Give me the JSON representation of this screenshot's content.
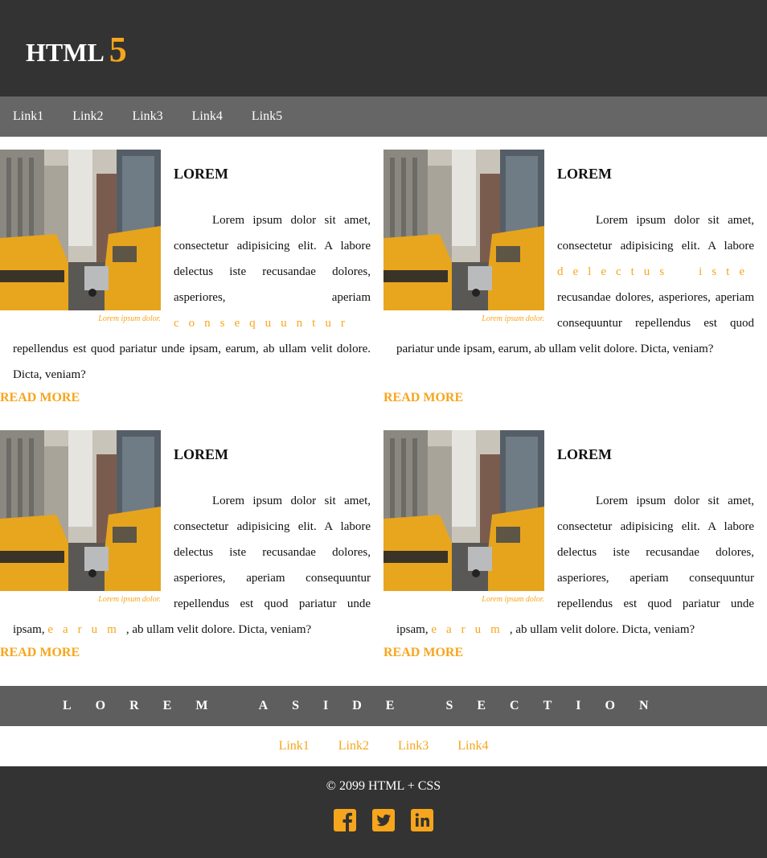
{
  "header": {
    "logo_text": "HTML",
    "logo_num": "5"
  },
  "nav": {
    "links": [
      "Link1",
      "Link2",
      "Link3",
      "Link4",
      "Link5"
    ]
  },
  "articles": [
    {
      "title": "LOREM",
      "caption": "Lorem ipsum dolor.",
      "text_1": "Lorem ipsum dolor sit amet, consectetur adipisicing elit. A labore delectus iste recusandae dolores, asperiores, aperiam",
      "highlight": "consequuntur",
      "text_2": " repellendus est quod pariatur unde ipsam, earum, ab ullam velit dolore. Dicta, veniam?",
      "read_more": "READ MORE"
    },
    {
      "title": "LOREM",
      "caption": "Lorem ipsum dolor.",
      "text_1": "Lorem ipsum dolor sit amet, consectetur adipisicing elit. A labore ",
      "highlight": "delectus iste",
      "text_2": " recusandae dolores, asperiores, aperiam consequuntur repellendus est quod pariatur unde ipsam, earum, ab ullam velit dolore. Dicta, veniam?",
      "read_more": "READ MORE"
    },
    {
      "title": "LOREM",
      "caption": "Lorem ipsum dolor.",
      "text_1": "Lorem ipsum dolor sit amet, consectetur adipisicing elit. A labore delectus iste recusandae dolores, asperiores, aperiam consequuntur repellendus est quod pariatur unde ipsam, ",
      "highlight": "earum",
      "text_2": ", ab ullam velit dolore. Dicta, veniam?",
      "read_more": "READ MORE"
    },
    {
      "title": "LOREM",
      "caption": "Lorem ipsum dolor.",
      "text_1": "Lorem ipsum dolor sit amet, consectetur adipisicing elit. A labore delectus iste recusandae dolores, asperiores, aperiam consequuntur repellendus est quod pariatur unde ipsam, ",
      "highlight": "earum",
      "text_2": ", ab ullam velit dolore. Dicta, veniam?",
      "read_more": "READ MORE"
    }
  ],
  "aside": {
    "title": "LOREM ASIDE SECTION"
  },
  "footer_nav": {
    "links": [
      "Link1",
      "Link2",
      "Link3",
      "Link4"
    ]
  },
  "footer": {
    "copyright": "© 2099 HTML + CSS",
    "social_icons": [
      "facebook-icon",
      "twitter-icon",
      "linkedin-icon"
    ]
  },
  "colors": {
    "accent": "#f7a51c",
    "header_bg": "#333333",
    "nav_bg": "#666666"
  }
}
